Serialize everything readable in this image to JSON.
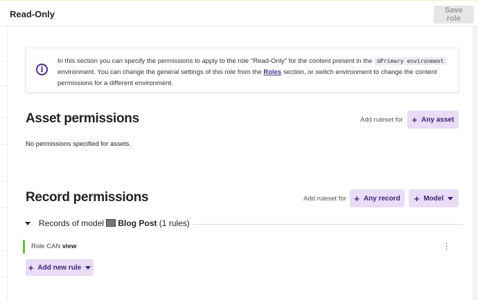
{
  "header": {
    "title": "Read-Only",
    "save_label": "Save role"
  },
  "info": {
    "text_1": "In this section you can specify the permissions to apply to the role \"Read-Only\" for the content present in the",
    "env_name": "Primary environment",
    "text_2": "environment. You can change the general settings of this role from the",
    "roles_link": "Roles",
    "text_3": "section, or switch environment to change the content permissions for a different environment."
  },
  "asset_permissions": {
    "heading": "Asset permissions",
    "add_ruleset_label": "Add ruleset for",
    "any_asset_label": "Any asset",
    "empty_text": "No permissions specified for assets."
  },
  "record_permissions": {
    "heading": "Record permissions",
    "add_ruleset_label": "Add ruleset for",
    "any_record_label": "Any record",
    "model_label": "Model",
    "group": {
      "prefix": "Records of model",
      "model_name": "Blog Post",
      "count": "(1 rules)"
    },
    "rules": [
      {
        "text": "Role CAN",
        "action": "view"
      }
    ],
    "add_rule_label": "Add new rule"
  }
}
